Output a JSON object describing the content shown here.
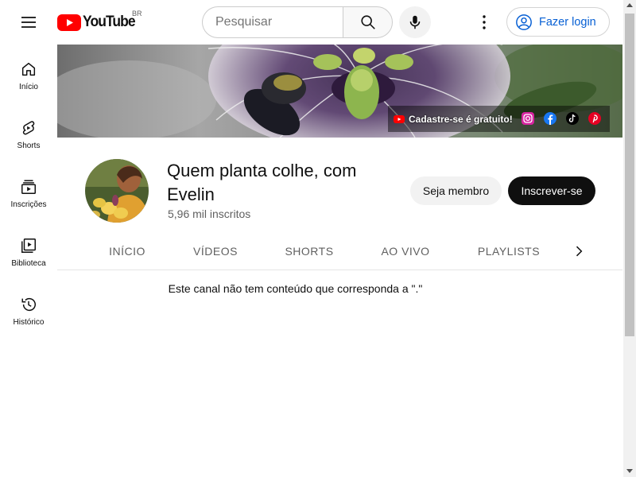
{
  "header": {
    "logo_text": "YouTube",
    "country_code": "BR",
    "search_placeholder": "Pesquisar",
    "login_label": "Fazer login"
  },
  "sidebar": {
    "items": [
      {
        "label": "Início",
        "icon": "home-icon"
      },
      {
        "label": "Shorts",
        "icon": "shorts-icon"
      },
      {
        "label": "Inscrições",
        "icon": "subscriptions-icon"
      },
      {
        "label": "Biblioteca",
        "icon": "library-icon"
      },
      {
        "label": "Histórico",
        "icon": "history-icon"
      }
    ]
  },
  "banner": {
    "cta_label": "Cadastre-se é gratuito!",
    "social_links": [
      "instagram-icon",
      "facebook-icon",
      "tiktok-icon",
      "pinterest-icon"
    ]
  },
  "channel": {
    "name": "Quem planta colhe, com Evelin",
    "subscribers": "5,96 mil inscritos",
    "member_label": "Seja membro",
    "subscribe_label": "Inscrever-se"
  },
  "tabs": [
    "INÍCIO",
    "VÍDEOS",
    "SHORTS",
    "AO VIVO",
    "PLAYLISTS"
  ],
  "content": {
    "empty_message": "Este canal não tem conteúdo que corresponda a \".\""
  },
  "colors": {
    "brand_red": "#ff0000",
    "link_blue": "#065fd4",
    "subscribe_bg": "#0f0f0f"
  }
}
